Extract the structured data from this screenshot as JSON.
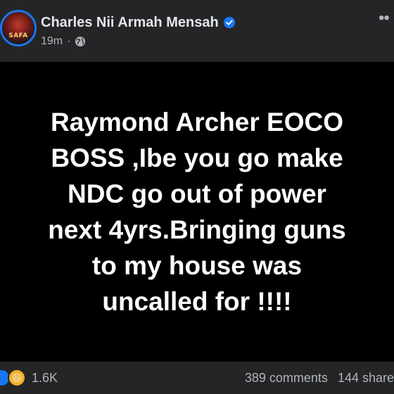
{
  "post": {
    "author": "Charles Nii Armah Mensah",
    "avatar_label": "SAFA",
    "time": "19m",
    "separator": "·",
    "more_icon": "more-dots-icon",
    "image_text": "Raymond Archer EOCO\nBOSS ,Ibe you go make\nNDC go out of power\nnext 4yrs.Bringing guns\nto my house was\nuncalled for !!!!"
  },
  "footer": {
    "reaction_count": "1.6K",
    "comments": "389 comments",
    "shares": "144 share"
  },
  "colors": {
    "background": "#242526",
    "verified": "#1877f2",
    "image_bg": "#000000",
    "text_primary": "#e4e6eb",
    "text_secondary": "#b0b3b8"
  }
}
